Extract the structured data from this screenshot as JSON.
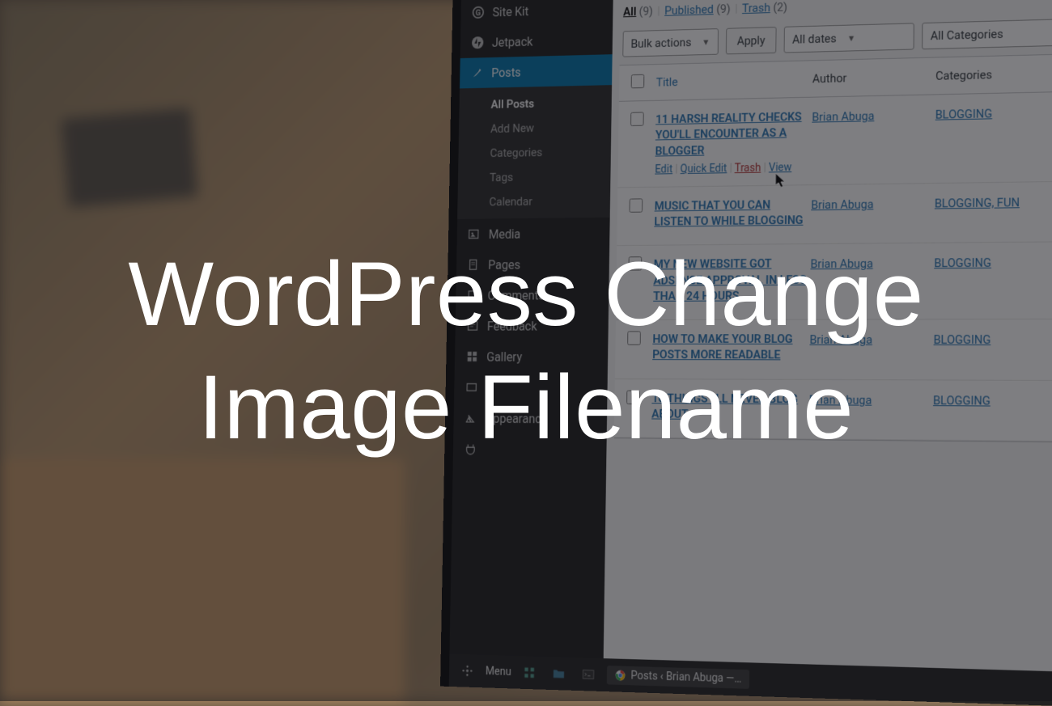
{
  "overlay": {
    "headline": "WordPress Change Image Filename"
  },
  "taskbar": {
    "menu_label": "Menu",
    "tab_title": "Posts ‹ Brian Abuga —…"
  },
  "sidebar": {
    "top_items": [
      {
        "icon": "sitekit",
        "label": "Site Kit"
      },
      {
        "icon": "jetpack",
        "label": "Jetpack"
      }
    ],
    "posts_label": "Posts",
    "posts_submenu": [
      "All Posts",
      "Add New",
      "Categories",
      "Tags",
      "Calendar"
    ],
    "bottom_items": [
      {
        "icon": "media",
        "label": "Media"
      },
      {
        "icon": "pages",
        "label": "Pages"
      },
      {
        "icon": "comments",
        "label": "Comments"
      },
      {
        "icon": "feedback",
        "label": "Feedback"
      },
      {
        "icon": "gallery",
        "label": "Gallery"
      },
      {
        "icon": "generic",
        "label": ""
      },
      {
        "icon": "appearance",
        "label": "Appearance"
      },
      {
        "icon": "plugins",
        "label": ""
      }
    ],
    "collapse_label": "Menu"
  },
  "status_filters": {
    "all": {
      "label": "All",
      "count": "(9)"
    },
    "published": {
      "label": "Published",
      "count": "(9)"
    },
    "trash": {
      "label": "Trash",
      "count": "(2)"
    }
  },
  "tablenav": {
    "bulk_actions": "Bulk actions",
    "apply": "Apply",
    "all_dates": "All dates",
    "all_categories": "All Categories"
  },
  "columns": {
    "title": "Title",
    "author": "Author",
    "categories": "Categories"
  },
  "row_actions": {
    "edit": "Edit",
    "quick_edit": "Quick Edit",
    "trash": "Trash",
    "view": "View"
  },
  "posts": [
    {
      "title": "11 HARSH REALITY CHECKS YOU'LL ENCOUNTER AS A BLOGGER",
      "author": "Brian Abuga",
      "categories": "BLOGGING",
      "show_actions": true
    },
    {
      "title": "MUSIC THAT YOU CAN LISTEN TO WHILE BLOGGING",
      "author": "Brian Abuga",
      "categories": "BLOGGING, FUN",
      "show_actions": false
    },
    {
      "title": "MY NEW WEBSITE GOT ADSENSE APPROVAL IN LESS THAN 24 HOURS",
      "author": "Brian Abuga",
      "categories": "BLOGGING",
      "show_actions": false
    },
    {
      "title": "HOW TO MAKE YOUR BLOG POSTS MORE READABLE",
      "author": "Brian Abuga",
      "categories": "BLOGGING",
      "show_actions": false
    },
    {
      "title": "10 THINGS I'LL NEVER BLOG ABOUT",
      "author": "Brian Abuga",
      "categories": "BLOGGING",
      "show_actions": false
    }
  ]
}
